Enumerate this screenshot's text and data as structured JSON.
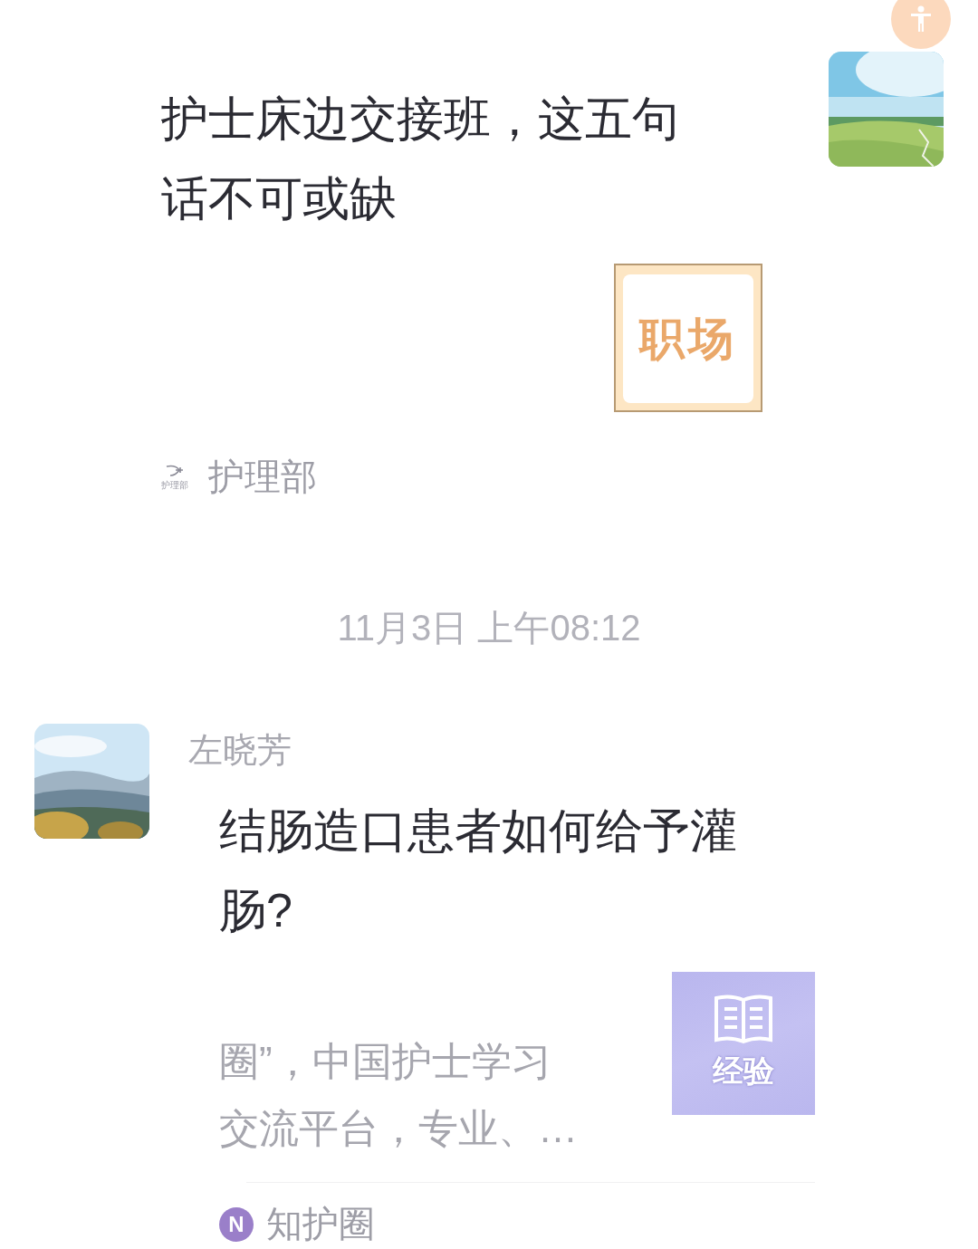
{
  "messages": [
    {
      "kind": "outgoing",
      "title": "护士床边交接班，这五句话不可或缺",
      "thumbnail": {
        "kind": "calendar",
        "label": "职场"
      },
      "source": {
        "kind": "wing",
        "name": "护理部",
        "icon_caption": "护理部"
      }
    },
    {
      "kind": "timestamp",
      "text": "11月3日 上午08:12"
    },
    {
      "kind": "incoming",
      "sender": "左晓芳",
      "title": "结肠造口患者如何给予灌肠?",
      "description_lines": [
        "圈”，中国护士学习",
        "交流平台，专业、…"
      ],
      "thumbnail": {
        "kind": "book",
        "label": "经验"
      },
      "source": {
        "kind": "badge",
        "name": "知护圈",
        "badge_letter": "N"
      }
    }
  ]
}
